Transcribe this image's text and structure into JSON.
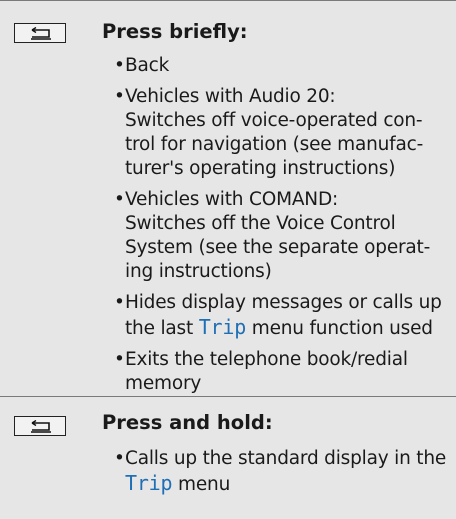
{
  "press_briefly": {
    "heading": "Press briefly:",
    "items": [
      {
        "lines": [
          "Back"
        ]
      },
      {
        "lines": [
          "Vehicles with Audio 20:",
          "Switches off voice-operated con-",
          "trol for navigation (see manufac-",
          "turer's operating instructions)"
        ]
      },
      {
        "lines": [
          "Vehicles with COMAND:",
          "Switches off the Voice Control",
          "System (see the separate operat-",
          "ing instructions)"
        ]
      },
      {
        "lines_a": "Hides display messages or calls up",
        "line_b_pre": "the last ",
        "line_b_mono": "Trip",
        "line_b_post": " menu function used"
      },
      {
        "lines": [
          "Exits the telephone book/redial",
          "memory"
        ]
      }
    ]
  },
  "press_hold": {
    "heading": "Press and hold:",
    "items": [
      {
        "line_a": "Calls up the standard display in the",
        "line_b_pre": "",
        "line_b_mono": "Trip",
        "line_b_post": " menu"
      }
    ]
  },
  "icons": {
    "key": "back-button-icon"
  },
  "colors": {
    "cell_bg": "#e6e6e6",
    "link": "#1f6fb5"
  }
}
